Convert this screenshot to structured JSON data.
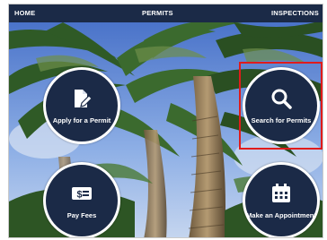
{
  "nav": {
    "home": "HOME",
    "permits": "PERMITS",
    "inspections": "INSPECTIONS"
  },
  "actions": {
    "apply": {
      "label": "Apply for a Permit",
      "icon": "document-pencil-icon"
    },
    "search": {
      "label": "Search for Permits",
      "icon": "magnifier-icon"
    },
    "pay": {
      "label": "Pay Fees",
      "icon": "dollar-bill-icon"
    },
    "appointment": {
      "label": "Make an Appointment",
      "icon": "calendar-icon"
    }
  },
  "colors": {
    "navy": "#1b2a47",
    "highlight": "#e01b1b",
    "sky": "#6f93d6"
  }
}
